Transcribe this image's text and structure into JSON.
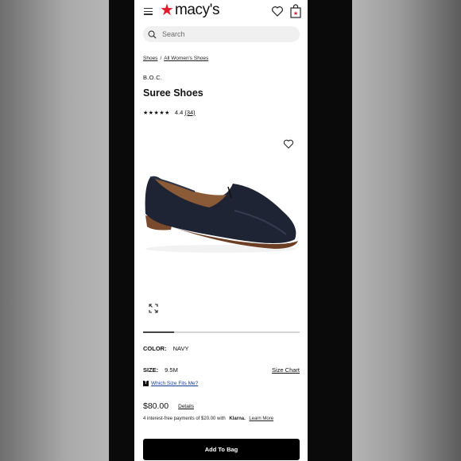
{
  "header": {
    "logo_text": "macy's",
    "brand_color": "#e21a2c",
    "icons": [
      "menu-icon",
      "star-icon",
      "heart-icon",
      "shopping-bag-icon"
    ]
  },
  "search": {
    "placeholder": "Search",
    "icon": "search-icon"
  },
  "breadcrumb": {
    "items": [
      "Shoes",
      "All Women's Shoes"
    ],
    "separator": "/"
  },
  "product": {
    "brand": "B.O.C.",
    "name": "Suree Shoes",
    "rating": {
      "stars": "★★★★★",
      "value": "4.4",
      "count": "(34)",
      "score": 4.4
    },
    "image_icons": [
      "heart-icon",
      "expand-icon"
    ],
    "carousel_progress": 0.2
  },
  "options": {
    "color_label": "COLOR:",
    "color_value": "NAVY",
    "size_label": "SIZE:",
    "size_value": "9.5M",
    "size_chart_link": "Size Chart",
    "fit_badge": "T",
    "fit_link": "Which Size Fits Me?"
  },
  "pricing": {
    "price": "$80.00",
    "details_link": "Details",
    "klarna_prefix": "4 interest-free payments of $20.00 with",
    "klarna_brand": "Klarna.",
    "learn_more": "Learn More"
  },
  "cta": {
    "add_to_bag": "Add To Bag"
  }
}
